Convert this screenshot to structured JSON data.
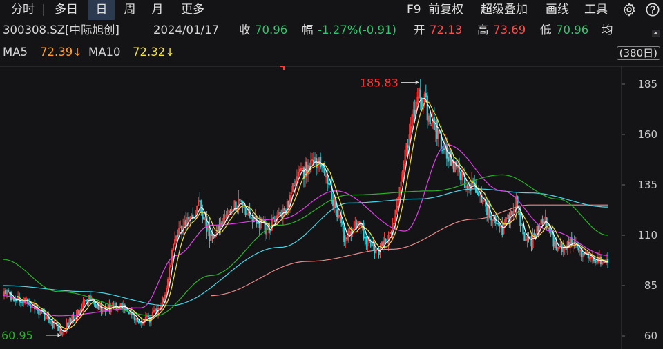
{
  "toolbar": {
    "tabs": [
      "分时",
      "多日",
      "日",
      "周",
      "月",
      "更多"
    ],
    "active_tab": 2,
    "tools": [
      "F9",
      "前复权",
      "超级叠加",
      "画线",
      "工具"
    ],
    "icons": [
      "gear-icon",
      "help-icon"
    ]
  },
  "quote": {
    "code": "300308.SZ[中际旭创]",
    "date": "2024/01/17",
    "close_label": "收",
    "close": "70.96",
    "change_label": "幅",
    "change": "-1.27%(-0.91)",
    "open_label": "开",
    "open": "72.13",
    "high_label": "高",
    "high": "73.69",
    "low_label": "低",
    "low": "70.96",
    "avg_label": "均"
  },
  "ma": {
    "ma5_label": "MA5",
    "ma5": "72.39↓",
    "ma10_label": "MA10",
    "ma10": "72.32↓",
    "days": "(380日)"
  },
  "colors": {
    "up": "#ff3b3b",
    "down": "#2ccfd8",
    "ma5": "#ffffff",
    "ma10": "#f2e33a",
    "ma20": "#e040e8",
    "ma60": "#2bb32b",
    "ma120": "#48d7e8",
    "ma250": "#e88a8a"
  },
  "chart_data": {
    "type": "candlestick",
    "y_ticks": [
      185,
      160,
      135,
      110,
      85,
      60
    ],
    "ylim": [
      57,
      190
    ],
    "bars": 380,
    "annotations": [
      {
        "text": "185.83",
        "bar": 300,
        "value": 185.83,
        "kind": "high"
      },
      {
        "text": "60.95",
        "bar": 42,
        "value": 60.95,
        "kind": "low"
      }
    ],
    "anchors": [
      [
        0,
        82
      ],
      [
        12,
        78
      ],
      [
        24,
        74
      ],
      [
        36,
        66
      ],
      [
        42,
        62
      ],
      [
        52,
        70
      ],
      [
        62,
        78
      ],
      [
        72,
        73
      ],
      [
        86,
        76
      ],
      [
        96,
        68
      ],
      [
        106,
        68
      ],
      [
        116,
        78
      ],
      [
        124,
        108
      ],
      [
        134,
        118
      ],
      [
        142,
        125
      ],
      [
        150,
        108
      ],
      [
        160,
        116
      ],
      [
        170,
        128
      ],
      [
        180,
        118
      ],
      [
        192,
        113
      ],
      [
        204,
        124
      ],
      [
        214,
        140
      ],
      [
        228,
        148
      ],
      [
        236,
        132
      ],
      [
        246,
        110
      ],
      [
        256,
        116
      ],
      [
        262,
        108
      ],
      [
        270,
        100
      ],
      [
        280,
        112
      ],
      [
        290,
        148
      ],
      [
        300,
        182
      ],
      [
        310,
        166
      ],
      [
        320,
        150
      ],
      [
        330,
        140
      ],
      [
        340,
        132
      ],
      [
        350,
        122
      ],
      [
        360,
        112
      ],
      [
        370,
        126
      ],
      [
        376,
        110
      ],
      [
        380,
        105
      ],
      [
        390,
        118
      ],
      [
        400,
        102
      ],
      [
        410,
        108
      ],
      [
        420,
        100
      ],
      [
        430,
        98
      ],
      [
        436,
        96
      ]
    ],
    "ma20_anchors": [
      [
        0,
        80
      ],
      [
        40,
        70
      ],
      [
        100,
        74
      ],
      [
        125,
        100
      ],
      [
        150,
        115
      ],
      [
        200,
        118
      ],
      [
        240,
        132
      ],
      [
        290,
        112
      ],
      [
        320,
        155
      ],
      [
        360,
        132
      ],
      [
        395,
        112
      ],
      [
        436,
        100
      ]
    ],
    "ma60_anchors": [
      [
        0,
        98
      ],
      [
        40,
        82
      ],
      [
        110,
        70
      ],
      [
        150,
        90
      ],
      [
        200,
        115
      ],
      [
        250,
        130
      ],
      [
        310,
        132
      ],
      [
        360,
        140
      ],
      [
        400,
        128
      ],
      [
        436,
        110
      ]
    ],
    "ma120_anchors": [
      [
        0,
        85
      ],
      [
        60,
        82
      ],
      [
        120,
        75
      ],
      [
        200,
        104
      ],
      [
        250,
        126
      ],
      [
        300,
        128
      ],
      [
        340,
        133
      ],
      [
        380,
        131
      ],
      [
        436,
        124
      ]
    ],
    "ma250_anchors": [
      [
        150,
        80
      ],
      [
        220,
        97
      ],
      [
        280,
        103
      ],
      [
        340,
        118
      ],
      [
        380,
        125
      ],
      [
        436,
        125
      ]
    ]
  }
}
